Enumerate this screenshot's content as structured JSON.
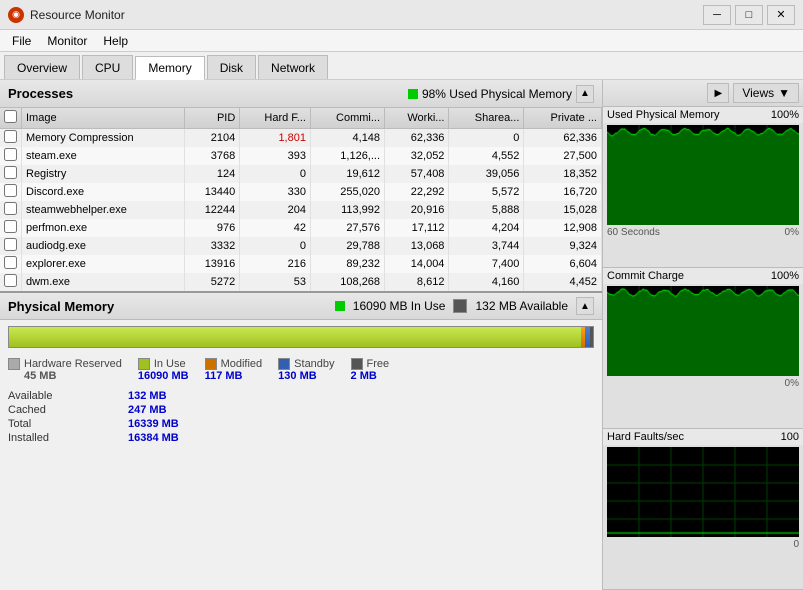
{
  "titleBar": {
    "title": "Resource Monitor",
    "icon": "●",
    "minBtn": "─",
    "maxBtn": "□",
    "closeBtn": "✕"
  },
  "menuBar": {
    "items": [
      "File",
      "Monitor",
      "Help"
    ]
  },
  "tabs": {
    "items": [
      "Overview",
      "CPU",
      "Memory",
      "Disk",
      "Network"
    ],
    "active": "Memory"
  },
  "processes": {
    "title": "Processes",
    "indicator": "98% Used Physical Memory",
    "columns": [
      "",
      "Image",
      "PID",
      "Hard F...",
      "Commi...",
      "Worki...",
      "Sharea...",
      "Private ..."
    ],
    "rows": [
      {
        "image": "Memory Compression",
        "pid": "2104",
        "hard": "1,801",
        "commit": "4,148",
        "working": "62,336",
        "shared": "0",
        "private": "62,336",
        "hardRed": true
      },
      {
        "image": "steam.exe",
        "pid": "3768",
        "hard": "393",
        "commit": "1,126,...",
        "working": "32,052",
        "shared": "4,552",
        "private": "27,500"
      },
      {
        "image": "Registry",
        "pid": "124",
        "hard": "0",
        "commit": "19,612",
        "working": "57,408",
        "shared": "39,056",
        "private": "18,352"
      },
      {
        "image": "Discord.exe",
        "pid": "13440",
        "hard": "330",
        "commit": "255,020",
        "working": "22,292",
        "shared": "5,572",
        "private": "16,720"
      },
      {
        "image": "steamwebhelper.exe",
        "pid": "12244",
        "hard": "204",
        "commit": "113,992",
        "working": "20,916",
        "shared": "5,888",
        "private": "15,028"
      },
      {
        "image": "perfmon.exe",
        "pid": "976",
        "hard": "42",
        "commit": "27,576",
        "working": "17,112",
        "shared": "4,204",
        "private": "12,908"
      },
      {
        "image": "audiodg.exe",
        "pid": "3332",
        "hard": "0",
        "commit": "29,788",
        "working": "13,068",
        "shared": "3,744",
        "private": "9,324"
      },
      {
        "image": "explorer.exe",
        "pid": "13916",
        "hard": "216",
        "commit": "89,232",
        "working": "14,004",
        "shared": "7,400",
        "private": "6,604"
      },
      {
        "image": "dwm.exe",
        "pid": "5272",
        "hard": "53",
        "commit": "108,268",
        "working": "8,612",
        "shared": "4,160",
        "private": "4,452"
      }
    ]
  },
  "physicalMemory": {
    "title": "Physical Memory",
    "inUse": "16090 MB In Use",
    "available": "132 MB Available",
    "legend": [
      {
        "label": "Hardware Reserved",
        "value": "45 MB",
        "color": "#aaaaaa"
      },
      {
        "label": "In Use",
        "value": "16090 MB",
        "color": "#a0c020"
      },
      {
        "label": "Modified",
        "value": "117 MB",
        "color": "#cc7000"
      },
      {
        "label": "Standby",
        "value": "130 MB",
        "color": "#3060b0"
      },
      {
        "label": "Free",
        "value": "2 MB",
        "color": "#555555"
      }
    ],
    "stats": [
      {
        "label": "Available",
        "value": "132 MB"
      },
      {
        "label": "Cached",
        "value": "247 MB"
      },
      {
        "label": "Total",
        "value": "16339 MB"
      },
      {
        "label": "Installed",
        "value": "16384 MB"
      }
    ]
  },
  "rightPanel": {
    "views": "Views",
    "graphs": [
      {
        "title": "Used Physical Memory",
        "percent": "100%",
        "bottomLeft": "60 Seconds",
        "bottomRight": "0%"
      },
      {
        "title": "Commit Charge",
        "percent": "100%",
        "bottomRight": "0%"
      },
      {
        "title": "Hard Faults/sec",
        "value": "100",
        "bottomRight": "0"
      }
    ]
  }
}
